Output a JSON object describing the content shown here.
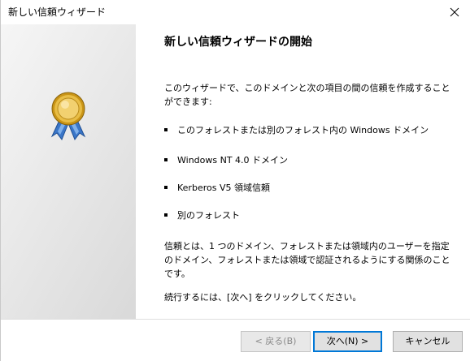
{
  "window": {
    "title": "新しい信頼ウィザード",
    "close_label": "×"
  },
  "content": {
    "heading": "新しい信頼ウィザードの開始",
    "intro": "このウィザードで、このドメインと次の項目の間の信頼を作成することができます:",
    "bullets": [
      "このフォレストまたは別のフォレスト内の Windows ドメイン",
      "Windows NT 4.0 ドメイン",
      "Kerberos V5 領域信頼",
      "別のフォレスト"
    ],
    "description": "信頼とは、1 つのドメイン、フォレストまたは領域内のユーザーを指定のドメイン、フォレストまたは領域で認証されるようにする関係のことです。",
    "continue_hint": "続行するには、[次へ] をクリックしてください。"
  },
  "buttons": {
    "back": "< 戻る(B)",
    "next": "次へ(N) >",
    "cancel": "キャンセル"
  },
  "icons": {
    "medal": "award-medal-icon",
    "close": "close-icon"
  },
  "colors": {
    "accent": "#0078d7",
    "medal_gold": "#e2b23a",
    "ribbon_blue": "#3a76c8"
  }
}
